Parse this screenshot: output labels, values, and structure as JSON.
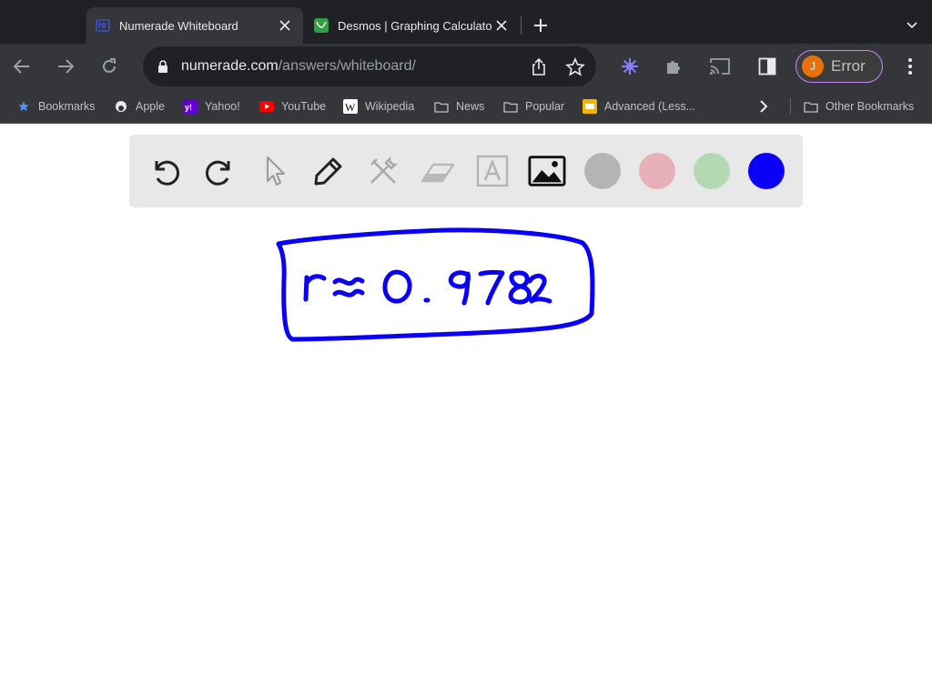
{
  "browser": {
    "tabs": [
      {
        "title": "Numerade Whiteboard",
        "active": true,
        "favicon": "numerade-icon"
      },
      {
        "title": "Desmos | Graphing Calculato",
        "active": false,
        "favicon": "desmos-icon"
      }
    ],
    "address_bar": {
      "host": "numerade.com",
      "path": "/answers/whiteboard/"
    },
    "profile": {
      "initial": "J",
      "status": "Error",
      "avatar_color": "#e8710a"
    },
    "bookmarks": [
      {
        "label": "Bookmarks",
        "icon": "star-icon"
      },
      {
        "label": "Apple",
        "icon": "apple-icon"
      },
      {
        "label": "Yahoo!",
        "icon": "yahoo-icon"
      },
      {
        "label": "YouTube",
        "icon": "youtube-icon"
      },
      {
        "label": "Wikipedia",
        "icon": "wikipedia-icon"
      },
      {
        "label": "News",
        "icon": "folder-icon"
      },
      {
        "label": "Popular",
        "icon": "folder-icon"
      },
      {
        "label": "Advanced (Less...",
        "icon": "slides-icon"
      }
    ],
    "other_bookmarks": "Other Bookmarks"
  },
  "whiteboard": {
    "tools": [
      "undo-icon",
      "redo-icon",
      "pointer-icon",
      "pen-icon",
      "tools-icon",
      "eraser-icon",
      "text-icon",
      "image-icon"
    ],
    "colors": [
      "#b4b4b4",
      "#e8b0b8",
      "#b4d8b4",
      "#0a00f5"
    ],
    "selected_color": "#0a00f5",
    "handwritten_text": "r ≈ 0.9782"
  }
}
